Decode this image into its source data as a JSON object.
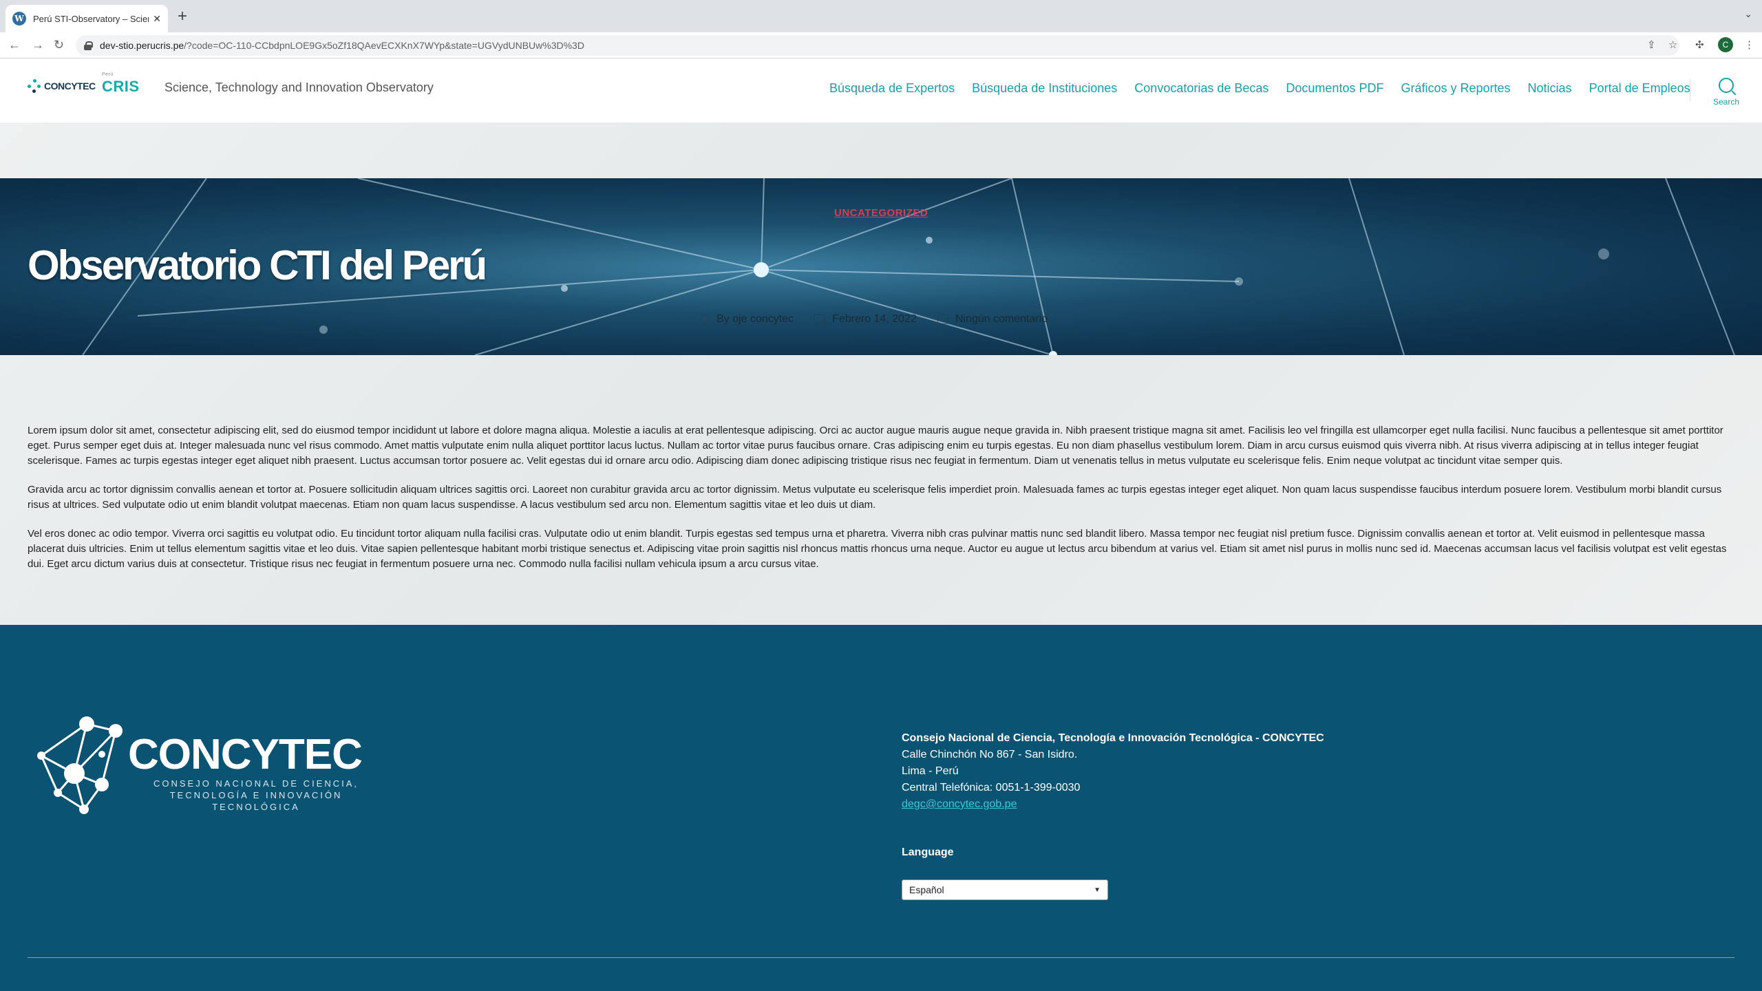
{
  "browser": {
    "tab_title": "Perú STI-Observatory – Scienc",
    "tab_close": "✕",
    "new_tab": "+",
    "url_host": "dev-stio.perucris.pe",
    "url_path": "/?code=OC-110-CCbdpnLOE9Gx5oZf18QAevECXKnX7WYp&state=UGVydUNBUw%3D%3D",
    "profile_initial": "C"
  },
  "header": {
    "logo_text": "CONCYTEC",
    "logo_cris_small": "Perú",
    "logo_cris": "CRIS",
    "tagline": "Science, Technology and Innovation Observatory",
    "nav": [
      {
        "label": "Búsqueda de Expertos"
      },
      {
        "label": "Búsqueda de Instituciones"
      },
      {
        "label": "Convocatorias de Becas"
      },
      {
        "label": "Documentos PDF"
      },
      {
        "label": "Gráficos y Reportes"
      },
      {
        "label": "Noticias"
      },
      {
        "label": "Portal de Empleos"
      }
    ],
    "search_label": "Search"
  },
  "hero": {
    "category": "UNCATEGORIZED",
    "title": "Observatorio CTI del Perú",
    "author": "By oje concytec",
    "date": "Febrero 14, 2022",
    "comments": "Ningún comentario"
  },
  "content": {
    "paragraphs": [
      "Lorem ipsum dolor sit amet, consectetur adipiscing elit, sed do eiusmod tempor incididunt ut labore et dolore magna aliqua. Molestie a iaculis at erat pellentesque adipiscing. Orci ac auctor augue mauris augue neque gravida in. Nibh praesent tristique magna sit amet. Facilisis leo vel fringilla est ullamcorper eget nulla facilisi. Nunc faucibus a pellentesque sit amet porttitor eget. Purus semper eget duis at. Integer malesuada nunc vel risus commodo. Amet mattis vulputate enim nulla aliquet porttitor lacus luctus. Nullam ac tortor vitae purus faucibus ornare. Cras adipiscing enim eu turpis egestas. Eu non diam phasellus vestibulum lorem. Diam in arcu cursus euismod quis viverra nibh. At risus viverra adipiscing at in tellus integer feugiat scelerisque. Fames ac turpis egestas integer eget aliquet nibh praesent. Luctus accumsan tortor posuere ac. Velit egestas dui id ornare arcu odio. Adipiscing diam donec adipiscing tristique risus nec feugiat in fermentum. Diam ut venenatis tellus in metus vulputate eu scelerisque felis. Enim neque volutpat ac tincidunt vitae semper quis.",
      "Gravida arcu ac tortor dignissim convallis aenean et tortor at. Posuere sollicitudin aliquam ultrices sagittis orci. Laoreet non curabitur gravida arcu ac tortor dignissim. Metus vulputate eu scelerisque felis imperdiet proin. Malesuada fames ac turpis egestas integer eget aliquet. Non quam lacus suspendisse faucibus interdum posuere lorem. Vestibulum morbi blandit cursus risus at ultrices. Sed vulputate odio ut enim blandit volutpat maecenas. Etiam non quam lacus suspendisse. A lacus vestibulum sed arcu non. Elementum sagittis vitae et leo duis ut diam.",
      "Vel eros donec ac odio tempor. Viverra orci sagittis eu volutpat odio. Eu tincidunt tortor aliquam nulla facilisi cras. Vulputate odio ut enim blandit. Turpis egestas sed tempus urna et pharetra. Viverra nibh cras pulvinar mattis nunc sed blandit libero. Massa tempor nec feugiat nisl pretium fusce. Dignissim convallis aenean et tortor at. Velit euismod in pellentesque massa placerat duis ultricies. Enim ut tellus elementum sagittis vitae et leo duis. Vitae sapien pellentesque habitant morbi tristique senectus et. Adipiscing vitae proin sagittis nisl rhoncus mattis rhoncus urna neque. Auctor eu augue ut lectus arcu bibendum at varius vel. Etiam sit amet nisl purus in mollis nunc sed id. Maecenas accumsan lacus vel facilisis volutpat est velit egestas dui. Eget arcu dictum varius duis at consectetur. Tristique risus nec feugiat in fermentum posuere urna nec. Commodo nulla facilisi nullam vehicula ipsum a arcu cursus vitae."
    ]
  },
  "footer": {
    "logo_word": "CONCYTEC",
    "logo_sub_line1": "CONSEJO NACIONAL DE CIENCIA,",
    "logo_sub_line2": "TECNOLOGÍA E INNOVACIÓN TECNOLÓGICA",
    "org": "Consejo Nacional de Ciencia, Tecnología e Innovación Tecnológica - CONCYTEC",
    "address": "Calle Chinchón No 867 - San Isidro.",
    "city": "Lima - Perú",
    "phone": "Central Telefónica: 0051-1-399-0030",
    "email": "degc@concytec.gob.pe",
    "language_label": "Language",
    "language_value": "Español"
  },
  "colors": {
    "accent": "#1a9fa6",
    "footer_bg": "#0b5372",
    "category": "#d43e52"
  }
}
